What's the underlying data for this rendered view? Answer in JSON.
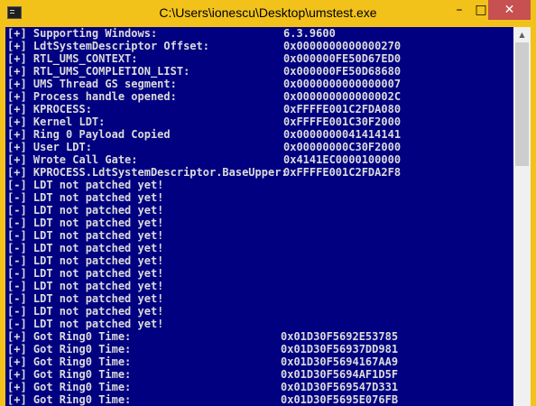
{
  "window": {
    "title": "C:\\Users\\ionescu\\Desktop\\umstest.exe",
    "icon": "console-app-icon",
    "accent": "#f2c21b",
    "buttons": {
      "minimize": "–",
      "maximize": "□",
      "close": "✕"
    }
  },
  "console": {
    "background": "#000080",
    "foreground": "#dcdcdc",
    "lines": [
      {
        "label": "[+] Supporting Windows:",
        "value": "6.3.9600"
      },
      {
        "label": "[+] LdtSystemDescriptor Offset:",
        "value": "0x0000000000000270"
      },
      {
        "label": "[+] RTL_UMS_CONTEXT:",
        "value": "0x000000FE50D67ED0"
      },
      {
        "label": "[+] RTL_UMS_COMPLETION_LIST:",
        "value": "0x000000FE50D68680"
      },
      {
        "label": "[+] UMS Thread GS segment:",
        "value": "0x0000000000000007"
      },
      {
        "label": "[+] Process handle opened:",
        "value": "0x000000000000002C"
      },
      {
        "label": "[+] KPROCESS:",
        "value": "0xFFFFE001C2FDA080"
      },
      {
        "label": "[+] Kernel LDT:",
        "value": "0xFFFFE001C30F2000"
      },
      {
        "label": "[+] Ring 0 Payload Copied",
        "value": "0x0000000041414141"
      },
      {
        "label": "[+] User LDT:",
        "value": "0x00000000C30F2000"
      },
      {
        "label": "[+] Wrote Call Gate:",
        "value": "0x4141EC0000100000"
      },
      {
        "label": "[+] KPROCESS.LdtSystemDescriptor.BaseUpper:",
        "value": "0xFFFFE001C2FDA2F8"
      },
      {
        "label": "[-] LDT not patched yet!",
        "value": ""
      },
      {
        "label": "[-] LDT not patched yet!",
        "value": ""
      },
      {
        "label": "[-] LDT not patched yet!",
        "value": ""
      },
      {
        "label": "[-] LDT not patched yet!",
        "value": ""
      },
      {
        "label": "[-] LDT not patched yet!",
        "value": ""
      },
      {
        "label": "[-] LDT not patched yet!",
        "value": ""
      },
      {
        "label": "[-] LDT not patched yet!",
        "value": ""
      },
      {
        "label": "[-] LDT not patched yet!",
        "value": ""
      },
      {
        "label": "[-] LDT not patched yet!",
        "value": ""
      },
      {
        "label": "[-] LDT not patched yet!",
        "value": ""
      },
      {
        "label": "[-] LDT not patched yet!",
        "value": ""
      },
      {
        "label": "[-] LDT not patched yet!",
        "value": ""
      },
      {
        "label": "[+] Got Ring0 Time:",
        "value": "0x01D30F5692E53785"
      },
      {
        "label": "[+] Got Ring0 Time:",
        "value": "0x01D30F56937DD981"
      },
      {
        "label": "[+] Got Ring0 Time:",
        "value": "0x01D30F5694167AA9"
      },
      {
        "label": "[+] Got Ring0 Time:",
        "value": "0x01D30F5694AF1D5F"
      },
      {
        "label": "[+] Got Ring0 Time:",
        "value": "0x01D30F569547D331"
      },
      {
        "label": "[+] Got Ring0 Time:",
        "value": "0x01D30F5695E076FB"
      }
    ]
  },
  "scrollbar": {
    "up_arrow": "▲",
    "thumb_fraction": 0.34
  }
}
